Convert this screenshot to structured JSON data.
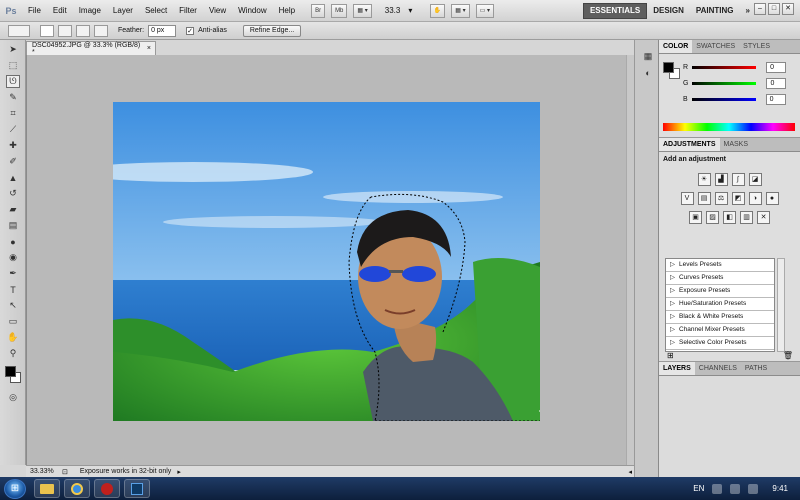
{
  "app": {
    "logo": "Ps",
    "menu": [
      "File",
      "Edit",
      "Image",
      "Layer",
      "Select",
      "Filter",
      "View",
      "Window",
      "Help"
    ],
    "bridge_label": "Br",
    "minibridge_label": "Mb",
    "zoom": "33.3",
    "workspaces": [
      "ESSENTIALS",
      "DESIGN",
      "PAINTING"
    ],
    "more_workspaces": "»",
    "window_controls": [
      "–",
      "□",
      "✕"
    ]
  },
  "options": {
    "feather_label": "Feather:",
    "feather_value": "0 px",
    "antialias_checked": "✓",
    "antialias_label": "Anti-alias",
    "refine_edge": "Refine Edge..."
  },
  "document": {
    "tab_title": "DSC04952.JPG @ 33.3% (RGB/8) *",
    "tab_close": "×",
    "status_zoom": "33.33%",
    "status_info": "Exposure works in 32-bit only"
  },
  "panels": {
    "color_tabs": [
      "COLOR",
      "SWATCHES",
      "STYLES"
    ],
    "channels": [
      {
        "label": "R",
        "value": "0"
      },
      {
        "label": "G",
        "value": "0"
      },
      {
        "label": "B",
        "value": "0"
      }
    ],
    "adjust_tabs": [
      "ADJUSTMENTS",
      "MASKS"
    ],
    "adjust_title": "Add an adjustment",
    "presets": [
      "Levels Presets",
      "Curves Presets",
      "Exposure Presets",
      "Hue/Saturation Presets",
      "Black & White Presets",
      "Channel Mixer Presets",
      "Selective Color Presets"
    ],
    "layers_tabs": [
      "LAYERS",
      "CHANNELS",
      "PATHS"
    ]
  },
  "taskbar": {
    "language": "EN",
    "time": "9:41"
  },
  "colors": {
    "accent": "#5f5f5f",
    "taskbar": "#1f3b66"
  }
}
